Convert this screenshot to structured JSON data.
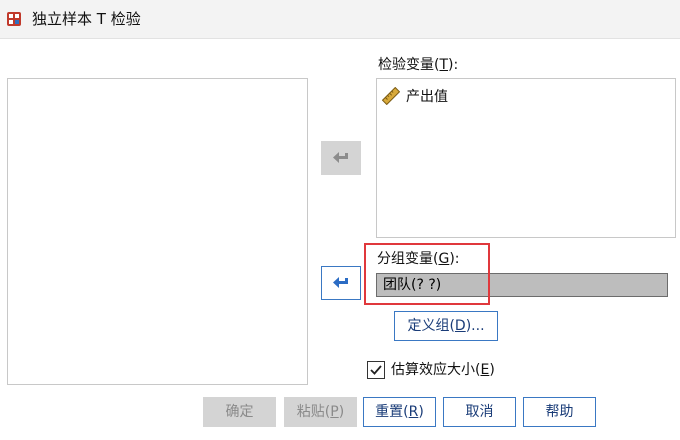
{
  "window": {
    "title": "独立样本 T 检验"
  },
  "test_variables": {
    "label": "检验变量",
    "mnemonic": "T",
    "label_suffix": ":",
    "items": [
      {
        "label": "产出值",
        "icon": "ruler-icon"
      }
    ]
  },
  "grouping_variable": {
    "label": "分组变量",
    "mnemonic": "G",
    "label_suffix": ":",
    "value": "团队(? ?)"
  },
  "define_groups_button": {
    "label": "定义组",
    "mnemonic": "D",
    "suffix": "..."
  },
  "effect_size": {
    "label": "估算效应大小",
    "mnemonic": "E",
    "checked": true
  },
  "buttons": {
    "ok": {
      "label": "确定"
    },
    "paste": {
      "label": "粘贴",
      "mnemonic": "P"
    },
    "reset": {
      "label": "重置",
      "mnemonic": "R"
    },
    "cancel": {
      "label": "取消"
    },
    "help": {
      "label": "帮助"
    }
  },
  "colors": {
    "accent": "#3a78c3",
    "highlight": "#e0383c",
    "disabled": "#d4d4d4",
    "field_bg": "#bdbdbd"
  }
}
